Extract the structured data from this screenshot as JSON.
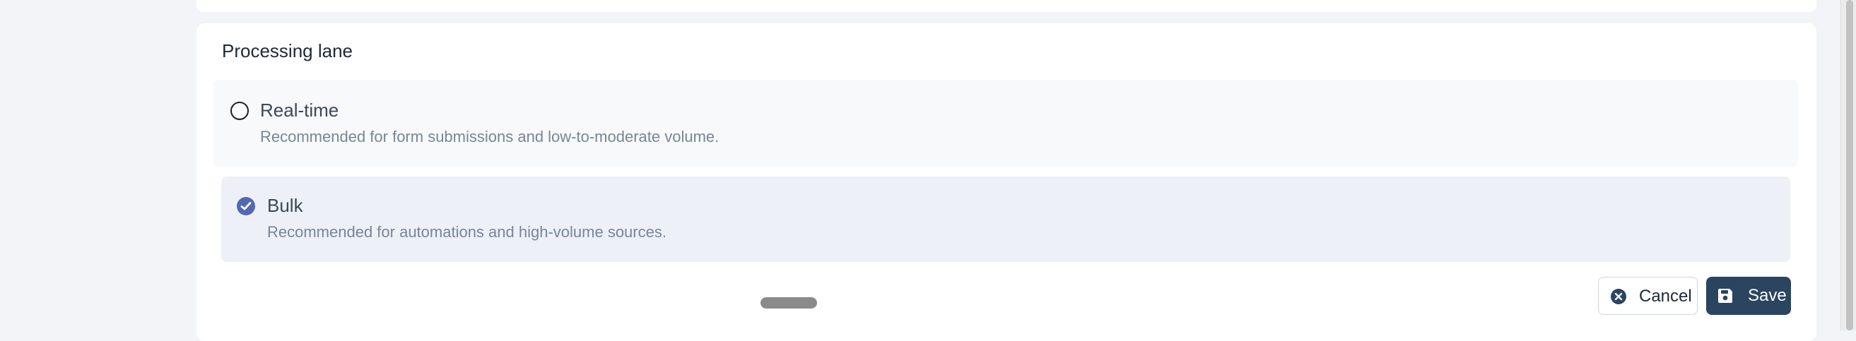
{
  "section": {
    "title": "Processing lane"
  },
  "options": [
    {
      "label": "Real-time",
      "description": "Recommended for form submissions and low-to-moderate volume.",
      "selected": false
    },
    {
      "label": "Bulk",
      "description": "Recommended for automations and high-volume sources.",
      "selected": true
    }
  ],
  "actions": {
    "cancel_label": "Cancel",
    "save_label": "Save"
  },
  "icons": {
    "cancel": "close-circle-icon",
    "save": "floppy-disk-icon",
    "radio_checked": "check-circle-icon"
  },
  "colors": {
    "accent": "#5468b0",
    "save_button": "#2b4460",
    "selected_option_bg": "#edf0f7"
  }
}
